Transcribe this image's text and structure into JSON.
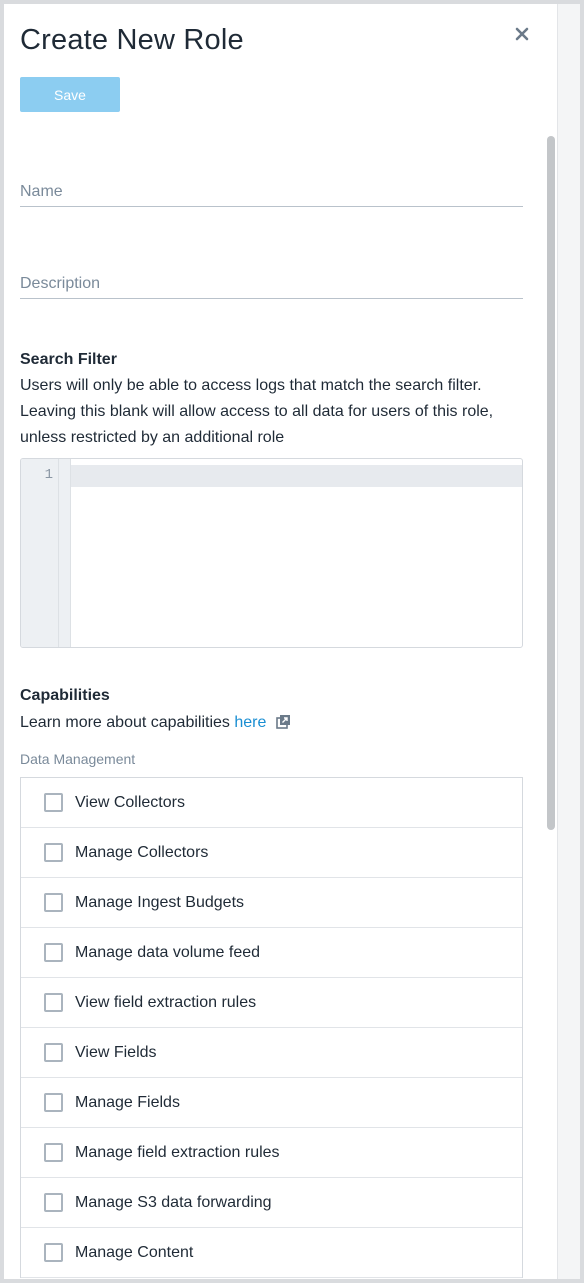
{
  "dialog": {
    "title": "Create New Role",
    "save_label": "Save"
  },
  "form": {
    "name_placeholder": "Name",
    "description_placeholder": "Description",
    "name_value": "",
    "description_value": ""
  },
  "search_filter": {
    "heading": "Search Filter",
    "description": "Users will only be able to access logs that match the search filter. Leaving this blank will allow access to all data for users of this role, unless restricted by an additional role",
    "line_number": "1",
    "value": ""
  },
  "capabilities": {
    "heading": "Capabilities",
    "learn_more_text": "Learn more about capabilities ",
    "learn_more_link": "here",
    "group_label": "Data Management",
    "items": [
      {
        "label": "View Collectors",
        "checked": false
      },
      {
        "label": "Manage Collectors",
        "checked": false
      },
      {
        "label": "Manage Ingest Budgets",
        "checked": false
      },
      {
        "label": "Manage data volume feed",
        "checked": false
      },
      {
        "label": "View field extraction rules",
        "checked": false
      },
      {
        "label": "View Fields",
        "checked": false
      },
      {
        "label": "Manage Fields",
        "checked": false
      },
      {
        "label": "Manage field extraction rules",
        "checked": false
      },
      {
        "label": "Manage S3 data forwarding",
        "checked": false
      },
      {
        "label": "Manage Content",
        "checked": false
      }
    ]
  },
  "colors": {
    "save_button": "#8ccdf1",
    "link": "#1a8ed2",
    "text": "#1f2a36",
    "muted": "#7a8a9a"
  },
  "icons": {
    "close": "close-icon",
    "external_link": "external-link-icon"
  }
}
